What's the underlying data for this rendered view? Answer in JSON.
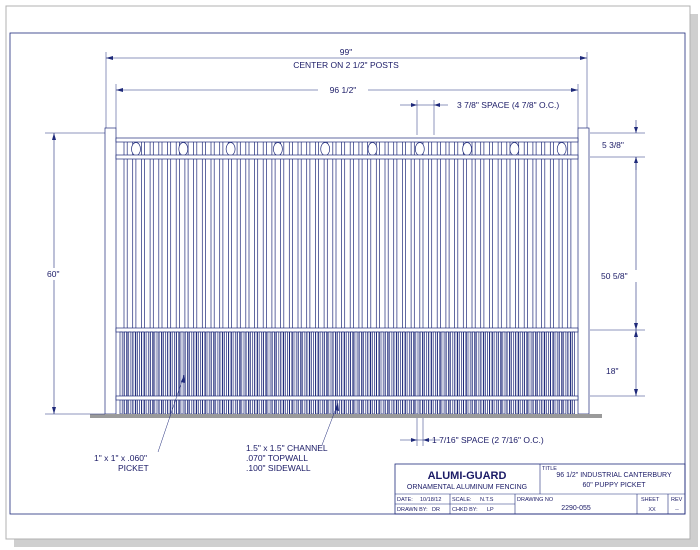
{
  "dimensions": {
    "overall": "99\"",
    "center_note": "CENTER ON 2 1/2\" POSTS",
    "section": "96 1/2\"",
    "picket_space": "3 7/8\" SPACE (4 7/8\" O.C.)",
    "top_gap": "5 3/8\"",
    "height": "60\"",
    "upper_height": "50 5/8\"",
    "lower_height": "18\"",
    "puppy_space": "1 7/16\" SPACE (2 7/16\" O.C.)"
  },
  "callouts": {
    "picket_line1": "1\" x 1\" x .060\"",
    "picket_line2": "PICKET",
    "channel_line1": "1.5\" x 1.5\" CHANNEL",
    "channel_line2": ".070\" TOPWALL",
    "channel_line3": ".100\" SIDEWALL"
  },
  "title_block": {
    "brand": "ALUMI-GUARD",
    "tagline": "ORNAMENTAL ALUMINUM FENCING",
    "title_label": "TITLE",
    "title_line1": "96 1/2\" INDUSTRIAL CANTERBURY",
    "title_line2": "60\" PUPPY PICKET",
    "date_label": "DATE:",
    "date": "10/18/12",
    "scale_label": "SCALE:",
    "scale": "N.T.S",
    "drawing_no_label": "DRAWING NO",
    "drawing_no": "2290-055",
    "sheet_label": "SHEET",
    "sheet": "XX",
    "rev_label": "REV",
    "rev": "--",
    "drawn_by_label": "DRAWN BY:",
    "drawn_by": "DR",
    "chkd_by_label": "CHKD BY:",
    "chkd_by": "LP"
  },
  "colors": {
    "line": "#1f2a7a",
    "text": "#1a1a66",
    "ground": "#9a9a9a"
  }
}
